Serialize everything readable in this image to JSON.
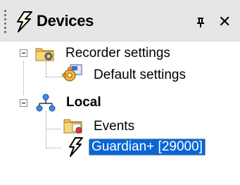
{
  "panel": {
    "title": "Devices",
    "header_icon": "lightning-device-icon",
    "pin_icon": "pin-icon",
    "close_icon": "close-icon",
    "close_glyph": "✕"
  },
  "tree": {
    "items": [
      {
        "label": "Recorder settings",
        "icon": "settings-folder-icon",
        "expanded": true
      },
      {
        "label": "Default settings",
        "icon": "default-settings-icon"
      },
      {
        "label": "Local",
        "icon": "network-local-icon",
        "expanded": true,
        "bold": true
      },
      {
        "label": "Events",
        "icon": "events-folder-icon"
      },
      {
        "label": "Guardian+ [29000]",
        "icon": "lightning-device-icon",
        "selected": true
      }
    ]
  },
  "colors": {
    "header_bg": "#e6e6e6",
    "selection_bg": "#0a66d6",
    "selection_text": "#ffffff",
    "folder_yellow": "#f2c24e"
  }
}
